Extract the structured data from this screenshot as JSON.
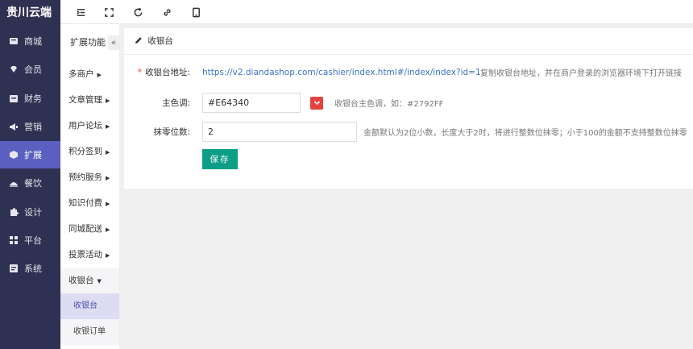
{
  "brand": "贵川云端",
  "sidebar": {
    "items": [
      {
        "label": "商城",
        "icon": "shop-icon",
        "active": false
      },
      {
        "label": "会员",
        "icon": "diamond-icon",
        "active": false
      },
      {
        "label": "财务",
        "icon": "wallet-icon",
        "active": false
      },
      {
        "label": "营销",
        "icon": "megaphone-icon",
        "active": false
      },
      {
        "label": "扩展",
        "icon": "cube-icon",
        "active": true
      },
      {
        "label": "餐饮",
        "icon": "dining-icon",
        "active": false
      },
      {
        "label": "设计",
        "icon": "puzzle-icon",
        "active": false
      },
      {
        "label": "平台",
        "icon": "grid-icon",
        "active": false
      },
      {
        "label": "系统",
        "icon": "system-icon",
        "active": false
      }
    ]
  },
  "toolbar": {
    "icons": [
      "indent-icon",
      "fullscreen-icon",
      "refresh-icon",
      "link-icon",
      "tablet-icon"
    ]
  },
  "subnav": {
    "title": "扩展功能",
    "collapse": "«",
    "items": [
      {
        "label": "多商户"
      },
      {
        "label": "文章管理"
      },
      {
        "label": "用户论坛"
      },
      {
        "label": "积分签到"
      },
      {
        "label": "预约服务"
      },
      {
        "label": "知识付费"
      },
      {
        "label": "同城配送"
      },
      {
        "label": "投票活动"
      },
      {
        "label": "收银台"
      }
    ],
    "children": [
      {
        "label": "收银台",
        "active": true
      },
      {
        "label": "收银订单",
        "active": false
      }
    ]
  },
  "panel": {
    "title": "收银台",
    "cashier_url_label": "收银台地址:",
    "cashier_url": "https://v2.diandashop.com/cashier/index.html#/index/index?id=1",
    "cashier_url_tip": "复制收银台地址，并在商户登录的浏览器环境下打开链接",
    "color_label": "主色调:",
    "color_value": "#E64340",
    "color_tip": "收银台主色调，如：#2792FF",
    "zero_label": "抹零位数:",
    "zero_value": "2",
    "zero_tip": "金额默认为2位小数，长度大于2时，将进行整数位抹零；小于100的金额不支持整数位抹零",
    "save_label": "保存"
  },
  "colors": {
    "sidebar_bg": "#2f3152",
    "sidebar_active": "#5b5fbf",
    "accent_color": "#e64340",
    "save_button": "#0e9e88"
  }
}
